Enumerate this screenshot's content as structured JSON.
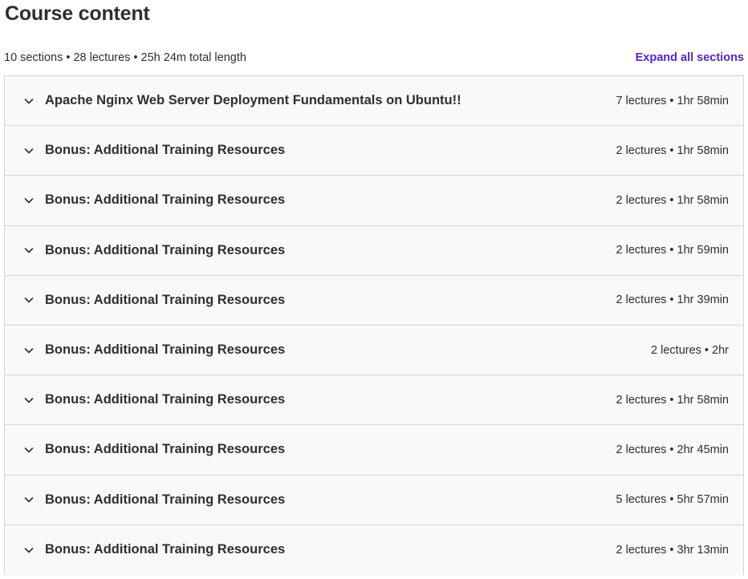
{
  "header": {
    "title": "Course content"
  },
  "summary": {
    "text": "10 sections • 28 lectures • 25h 24m total length",
    "expand_label": "Expand all sections"
  },
  "sections": [
    {
      "title": "Apache Nginx Web Server Deployment Fundamentals on Ubuntu!!",
      "meta": "7 lectures • 1hr 58min"
    },
    {
      "title": "Bonus: Additional Training Resources",
      "meta": "2 lectures • 1hr 58min"
    },
    {
      "title": "Bonus: Additional Training Resources",
      "meta": "2 lectures • 1hr 58min"
    },
    {
      "title": "Bonus: Additional Training Resources",
      "meta": "2 lectures • 1hr 59min"
    },
    {
      "title": "Bonus: Additional Training Resources",
      "meta": "2 lectures • 1hr 39min"
    },
    {
      "title": "Bonus: Additional Training Resources",
      "meta": "2 lectures • 2hr"
    },
    {
      "title": "Bonus: Additional Training Resources",
      "meta": "2 lectures • 1hr 58min"
    },
    {
      "title": "Bonus: Additional Training Resources",
      "meta": "2 lectures • 2hr 45min"
    },
    {
      "title": "Bonus: Additional Training Resources",
      "meta": "5 lectures • 5hr 57min"
    },
    {
      "title": "Bonus: Additional Training Resources",
      "meta": "2 lectures • 3hr 13min"
    }
  ],
  "icons": {
    "section_toggle": "chevron-down-icon"
  },
  "colors": {
    "accent": "#5624d0",
    "text": "#2d2f31",
    "section_bg": "#f7f9fa",
    "border": "#d1d7dc"
  }
}
